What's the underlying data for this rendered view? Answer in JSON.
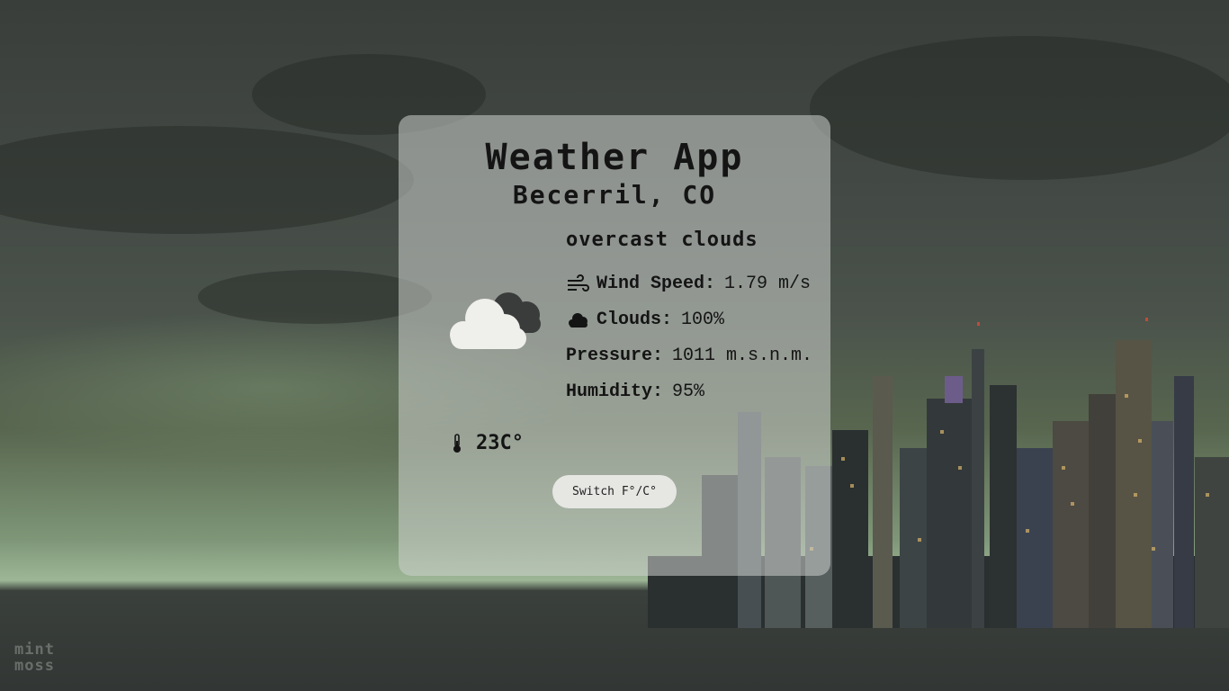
{
  "app": {
    "title": "Weather App",
    "location": "Becerril, CO"
  },
  "weather": {
    "description": "overcast clouds",
    "icon": "overcast-clouds-icon",
    "stats": [
      {
        "icon": "wind-icon",
        "label": "Wind Speed:",
        "value": "1.79 m/s"
      },
      {
        "icon": "cloud-icon",
        "label": "Clouds:",
        "value": "100%"
      },
      {
        "icon": "",
        "label": "Pressure:",
        "value": "1011 m.s.n.m."
      },
      {
        "icon": "",
        "label": "Humidity:",
        "value": "95%"
      }
    ],
    "temperature": "23C°",
    "temperature_icon": "thermometer-icon"
  },
  "controls": {
    "switch_label": "Switch F°/C°"
  },
  "branding": {
    "logo_line1": "mint",
    "logo_line2": "moss"
  },
  "colors": {
    "card_bg": "#cdd2cd",
    "text": "#141414",
    "button_bg": "#e6e6e3"
  }
}
